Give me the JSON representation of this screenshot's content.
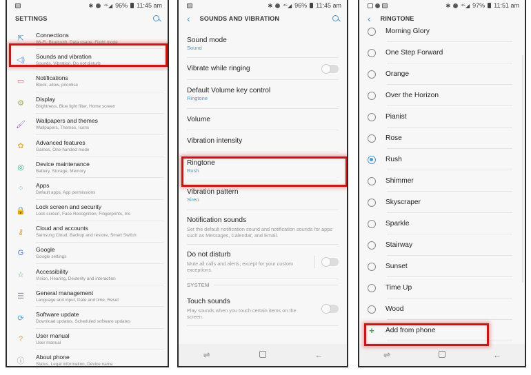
{
  "panel_settings": {
    "status": {
      "battery": "96%",
      "time": "11:45 am"
    },
    "title": "SETTINGS",
    "items": [
      {
        "label": "Connections",
        "sub": "Wi-Fi, Bluetooth, Data usage, Flight mode",
        "icon": "connections-icon",
        "glyph": "⇱",
        "color": "#4a9bc8"
      },
      {
        "label": "Sounds and vibration",
        "sub": "Sounds, Vibration, Do not disturb",
        "icon": "speaker-icon",
        "glyph": "◁)",
        "color": "#5b8fd0"
      },
      {
        "label": "Notifications",
        "sub": "Block, allow, prioritise",
        "icon": "notifications-icon",
        "glyph": "▭",
        "color": "#e07070"
      },
      {
        "label": "Display",
        "sub": "Brightness, Blue light filter, Home screen",
        "icon": "display-icon",
        "glyph": "⚙",
        "color": "#9ab04a"
      },
      {
        "label": "Wallpapers and themes",
        "sub": "Wallpapers, Themes, Icons",
        "icon": "wallpaper-icon",
        "glyph": "🖌",
        "color": "#a070c0"
      },
      {
        "label": "Advanced features",
        "sub": "Games, One-handed mode",
        "icon": "advanced-features-icon",
        "glyph": "✿",
        "color": "#e0b840"
      },
      {
        "label": "Device maintenance",
        "sub": "Battery, Storage, Memory",
        "icon": "device-maintenance-icon",
        "glyph": "◎",
        "color": "#40a890"
      },
      {
        "label": "Apps",
        "sub": "Default apps, App permissions",
        "icon": "apps-icon",
        "glyph": "⁘",
        "color": "#4a9bd0"
      },
      {
        "label": "Lock screen and security",
        "sub": "Lock screen, Face Recognition, Fingerprints, Iris",
        "icon": "lock-icon",
        "glyph": "🔒",
        "color": "#7080a0"
      },
      {
        "label": "Cloud and accounts",
        "sub": "Samsung Cloud, Backup and restore, Smart Switch",
        "icon": "key-icon",
        "glyph": "⚷",
        "color": "#e09040"
      },
      {
        "label": "Google",
        "sub": "Google settings",
        "icon": "google-icon",
        "glyph": "G",
        "color": "#4a80d0"
      },
      {
        "label": "Accessibility",
        "sub": "Vision, Hearing, Dexterity and interaction",
        "icon": "accessibility-icon",
        "glyph": "☆",
        "color": "#60b060"
      },
      {
        "label": "General management",
        "sub": "Language and input, Date and time, Reset",
        "icon": "sliders-icon",
        "glyph": "☰",
        "color": "#7a8a9a"
      },
      {
        "label": "Software update",
        "sub": "Download updates, Scheduled software updates",
        "icon": "software-update-icon",
        "glyph": "⟳",
        "color": "#4a9bd0"
      },
      {
        "label": "User manual",
        "sub": "User manual",
        "icon": "user-manual-icon",
        "glyph": "?",
        "color": "#e0a050"
      },
      {
        "label": "About phone",
        "sub": "Status, Legal information, Device name",
        "icon": "info-icon",
        "glyph": "ⓘ",
        "color": "#999999"
      }
    ]
  },
  "panel_sounds": {
    "status": {
      "battery": "96%",
      "time": "11:45 am"
    },
    "title": "SOUNDS AND VIBRATION",
    "items": [
      {
        "label": "Sound mode",
        "sub": "Sound"
      },
      {
        "label": "Vibrate while ringing",
        "toggle": false
      },
      {
        "label": "Default Volume key control",
        "sub": "Ringtone"
      },
      {
        "label": "Volume"
      },
      {
        "label": "Vibration intensity"
      },
      {
        "label": "Ringtone",
        "sub": "Rush"
      },
      {
        "label": "Vibration pattern",
        "sub": "Siren"
      },
      {
        "label": "Notification sounds",
        "desc": "Set the default notification sound and notification sounds for apps such as Messages, Calendar, and Email."
      },
      {
        "label": "Do not disturb",
        "desc": "Mute all calls and alerts, except for your custom exceptions.",
        "toggle": false
      }
    ],
    "section": "SYSTEM",
    "system_items": [
      {
        "label": "Touch sounds",
        "desc": "Play sounds when you touch certain items on the screen.",
        "toggle": false
      }
    ]
  },
  "panel_ringtone": {
    "status": {
      "battery": "97%",
      "time": "11:51 am"
    },
    "title": "RINGTONE",
    "options": [
      "Morning Glory",
      "One Step Forward",
      "Orange",
      "Over the Horizon",
      "Pianist",
      "Rose",
      "Rush",
      "Shimmer",
      "Skyscraper",
      "Sparkle",
      "Stairway",
      "Sunset",
      "Time Up",
      "Wood"
    ],
    "selected": "Rush",
    "add_label": "Add from phone"
  },
  "nav": {
    "recents": "⇌",
    "back": "←"
  },
  "highlight_color": "#c41919"
}
